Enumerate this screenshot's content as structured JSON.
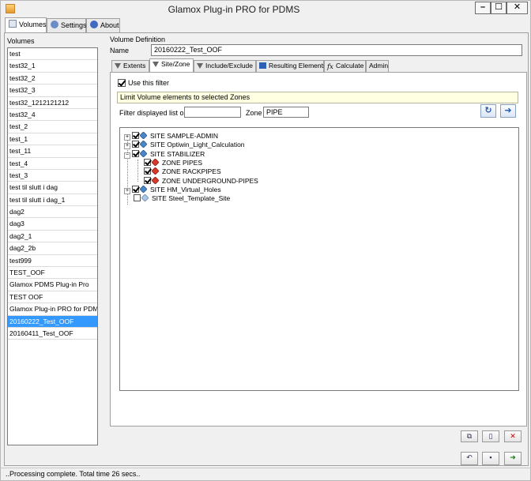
{
  "window": {
    "title": "Glamox Plug-in PRO for PDMS",
    "controls": {
      "minimize": "–",
      "maximize": "☐",
      "close": "✕"
    }
  },
  "top_tabs": [
    {
      "label": "Volumes",
      "icon": "volumes-icon",
      "active": true
    },
    {
      "label": "Settings",
      "icon": "settings-icon",
      "active": false
    },
    {
      "label": "About",
      "icon": "about-icon",
      "active": false
    }
  ],
  "volumes": {
    "label": "Volumes",
    "items": [
      "test",
      "test32_1",
      "test32_2",
      "test32_3",
      "test32_1212121212",
      "test32_4",
      "test_2",
      "test_1",
      "test_11",
      "test_4",
      "test_3",
      "test til slutt i dag",
      "test til slutt i dag_1",
      "dag2",
      "dag3",
      "dag2_1",
      "dag2_2b",
      "test999",
      "TEST_OOF",
      "Glamox PDMS Plug-in Pro",
      "TEST OOF",
      "Glamox Plug-in PRO for PDMS",
      "20160222_Test_OOF",
      "20160411_Test_OOF"
    ],
    "selected": "20160222_Test_OOF"
  },
  "volume_definition": {
    "label": "Volume Definition",
    "name_label": "Name",
    "name_value": "20160222_Test_OOF"
  },
  "sub_tabs": [
    {
      "label": "Extents",
      "icon": "funnel-icon",
      "active": false
    },
    {
      "label": "Site/Zone",
      "icon": "funnel-icon",
      "active": true
    },
    {
      "label": "Include/Exclude",
      "icon": "funnel-icon",
      "active": false
    },
    {
      "label": "Resulting Elements",
      "icon": "binoculars-icon",
      "active": false
    },
    {
      "label": "Calculate",
      "icon": "function-icon",
      "active": false
    },
    {
      "label": "Admin",
      "icon": "",
      "active": false
    }
  ],
  "site_zone": {
    "use_filter_label": "Use this filter",
    "use_filter_checked": true,
    "limit_text": "Limit Volume elements to selected Zones",
    "filter_label": "Filter displayed  list on Site",
    "site_filter_value": "",
    "zone_label": "Zone",
    "zone_filter_value": "PIPE",
    "refresh_icon": "refresh-icon",
    "apply_icon": "arrow-right-icon"
  },
  "tree": [
    {
      "label": "SITE SAMPLE-ADMIN",
      "type": "site",
      "level": 0,
      "expander": "+",
      "checked": true
    },
    {
      "label": "SITE Optiwin_Light_Calculation",
      "type": "site",
      "level": 0,
      "expander": "+",
      "checked": true
    },
    {
      "label": "SITE STABILIZER",
      "type": "site",
      "level": 0,
      "expander": "−",
      "checked": true
    },
    {
      "label": "ZONE PIPES",
      "type": "zone",
      "level": 1,
      "expander": "",
      "checked": true
    },
    {
      "label": "ZONE RACKPIPES",
      "type": "zone",
      "level": 1,
      "expander": "",
      "checked": true
    },
    {
      "label": "ZONE UNDERGROUND-PIPES",
      "type": "zone",
      "level": 1,
      "expander": "",
      "checked": true
    },
    {
      "label": "SITE HM_Virtual_Holes",
      "type": "site",
      "level": 0,
      "expander": "+",
      "checked": true
    },
    {
      "label": "SITE Steel_Template_Site",
      "type": "site-empty",
      "level": 0,
      "expander": "",
      "checked": false
    }
  ],
  "bottom_buttons": {
    "copy": "⧉",
    "new": "▯",
    "delete": "✕",
    "undo": "↶",
    "save": "▪",
    "exit": "➜"
  },
  "status": "..Processing complete. Total time 26 secs.."
}
